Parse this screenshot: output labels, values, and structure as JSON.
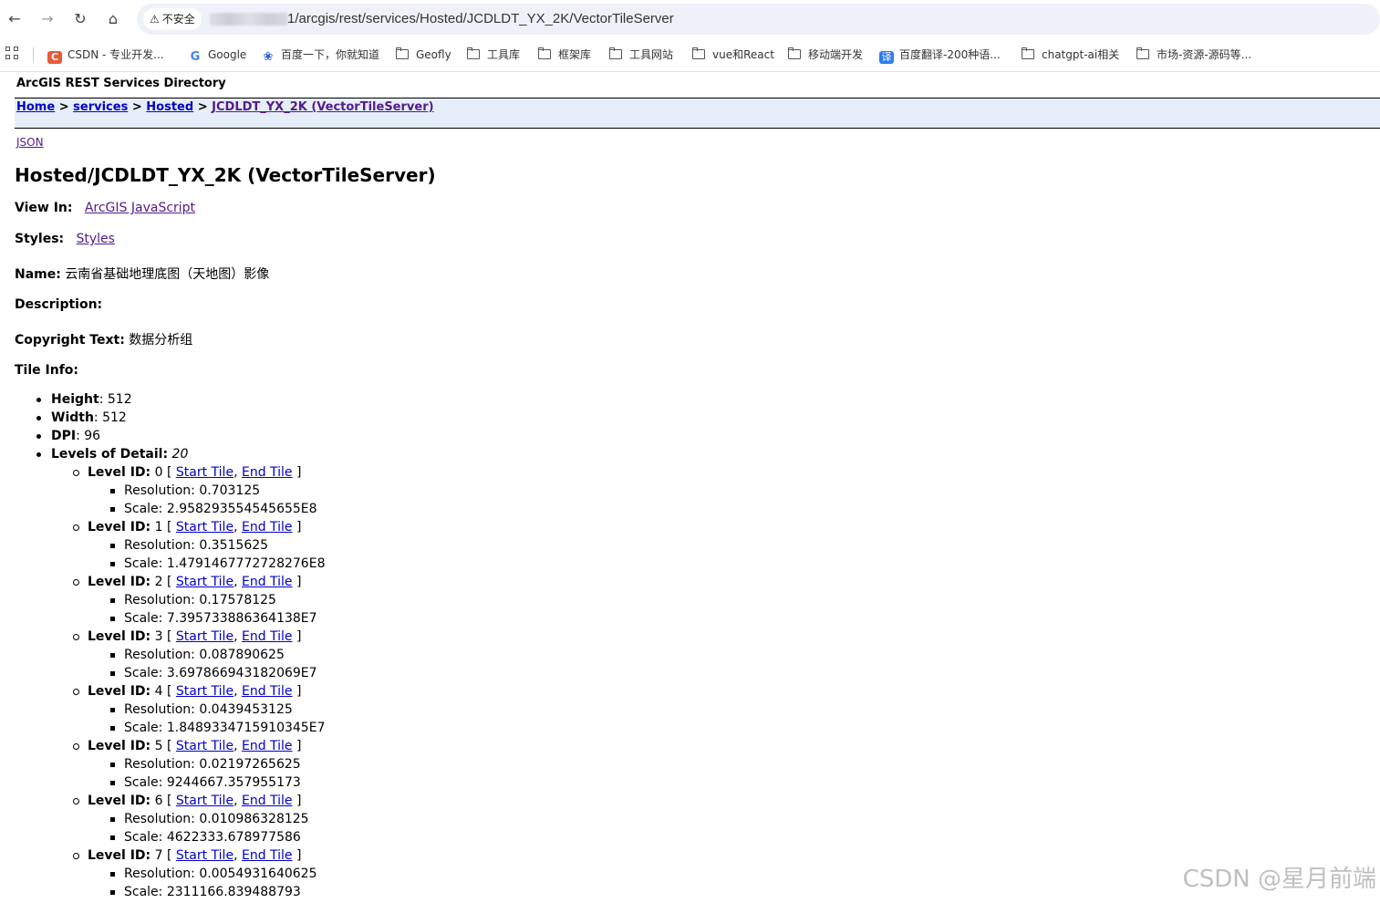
{
  "browser": {
    "security_label": "不安全",
    "url": "1/arcgis/rest/services/Hosted/JCDLDT_YX_2K/VectorTileServer",
    "bookmarks": [
      {
        "label": "CSDN - 专业开发...",
        "icon": "csdn-icon"
      },
      {
        "label": "Google",
        "icon": "google-icon"
      },
      {
        "label": "百度一下，你就知道",
        "icon": "baidu-icon"
      },
      {
        "label": "Geofly",
        "icon": "folder-icon"
      },
      {
        "label": "工具库",
        "icon": "folder-icon"
      },
      {
        "label": "框架库",
        "icon": "folder-icon"
      },
      {
        "label": "工具网站",
        "icon": "folder-icon"
      },
      {
        "label": "vue和React",
        "icon": "folder-icon"
      },
      {
        "label": "移动端开发",
        "icon": "folder-icon"
      },
      {
        "label": "百度翻译-200种语...",
        "icon": "fanyi-icon"
      },
      {
        "label": "chatgpt-ai相关",
        "icon": "folder-icon"
      },
      {
        "label": "市场-资源-源码等...",
        "icon": "folder-icon"
      }
    ]
  },
  "page": {
    "directory_title": "ArcGIS REST Services Directory",
    "breadcrumb": {
      "home": "Home",
      "services": "services",
      "hosted": "Hosted",
      "current": "JCDLDT_YX_2K (VectorTileServer)",
      "sep": ">"
    },
    "json_link": "JSON",
    "title": "Hosted/JCDLDT_YX_2K (VectorTileServer)",
    "view_in_label": "View In:",
    "view_in_link": "ArcGIS JavaScript",
    "styles_label": "Styles:",
    "styles_link": "Styles",
    "name_label": "Name:",
    "name_value": "云南省基础地理底图（天地图）影像",
    "description_label": "Description:",
    "copyright_label": "Copyright Text:",
    "copyright_value": "数据分析组",
    "tile_info_label": "Tile Info:",
    "tile_info": {
      "height_label": "Height",
      "height": "512",
      "width_label": "Width",
      "width": "512",
      "dpi_label": "DPI",
      "dpi": "96",
      "lod_label": "Levels of Detail:",
      "lod_count": "20"
    },
    "levels": [
      {
        "id": "0",
        "resolution": "0.703125",
        "scale": "2.958293554545655E8"
      },
      {
        "id": "1",
        "resolution": "0.3515625",
        "scale": "1.4791467772728276E8"
      },
      {
        "id": "2",
        "resolution": "0.17578125",
        "scale": "7.395733886364138E7"
      },
      {
        "id": "3",
        "resolution": "0.087890625",
        "scale": "3.697866943182069E7"
      },
      {
        "id": "4",
        "resolution": "0.0439453125",
        "scale": "1.8489334715910345E7"
      },
      {
        "id": "5",
        "resolution": "0.02197265625",
        "scale": "9244667.357955173"
      },
      {
        "id": "6",
        "resolution": "0.010986328125",
        "scale": "4622333.678977586"
      },
      {
        "id": "7",
        "resolution": "0.0054931640625",
        "scale": "2311166.839488793"
      }
    ],
    "level_labels": {
      "level_id": "Level ID:",
      "start_tile": "Start Tile",
      "end_tile": "End Tile",
      "resolution": "Resolution:",
      "scale": "Scale:"
    }
  },
  "watermark": "CSDN @星月前端",
  "colors": {
    "link": "#0000cc",
    "visited_link": "#551a8b",
    "breadcrumb_bg": "#e6eef9"
  }
}
